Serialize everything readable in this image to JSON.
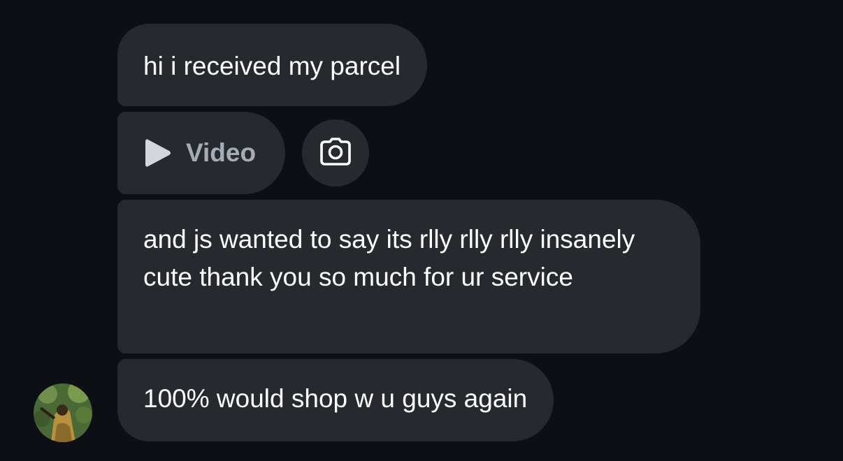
{
  "messages": [
    {
      "text": "hi i received my parcel"
    },
    {
      "type": "video",
      "label": "Video"
    },
    {
      "text": "and js wanted to say its rlly rlly rlly insanely cute thank you so much for ur service"
    },
    {
      "text": "100% would shop w u guys again"
    }
  ],
  "icons": {
    "video": "play-icon",
    "camera": "camera-icon"
  },
  "colors": {
    "background": "#0c1014",
    "bubble": "#262a2f",
    "text": "#ffffff",
    "video_label": "#a5acb6"
  }
}
